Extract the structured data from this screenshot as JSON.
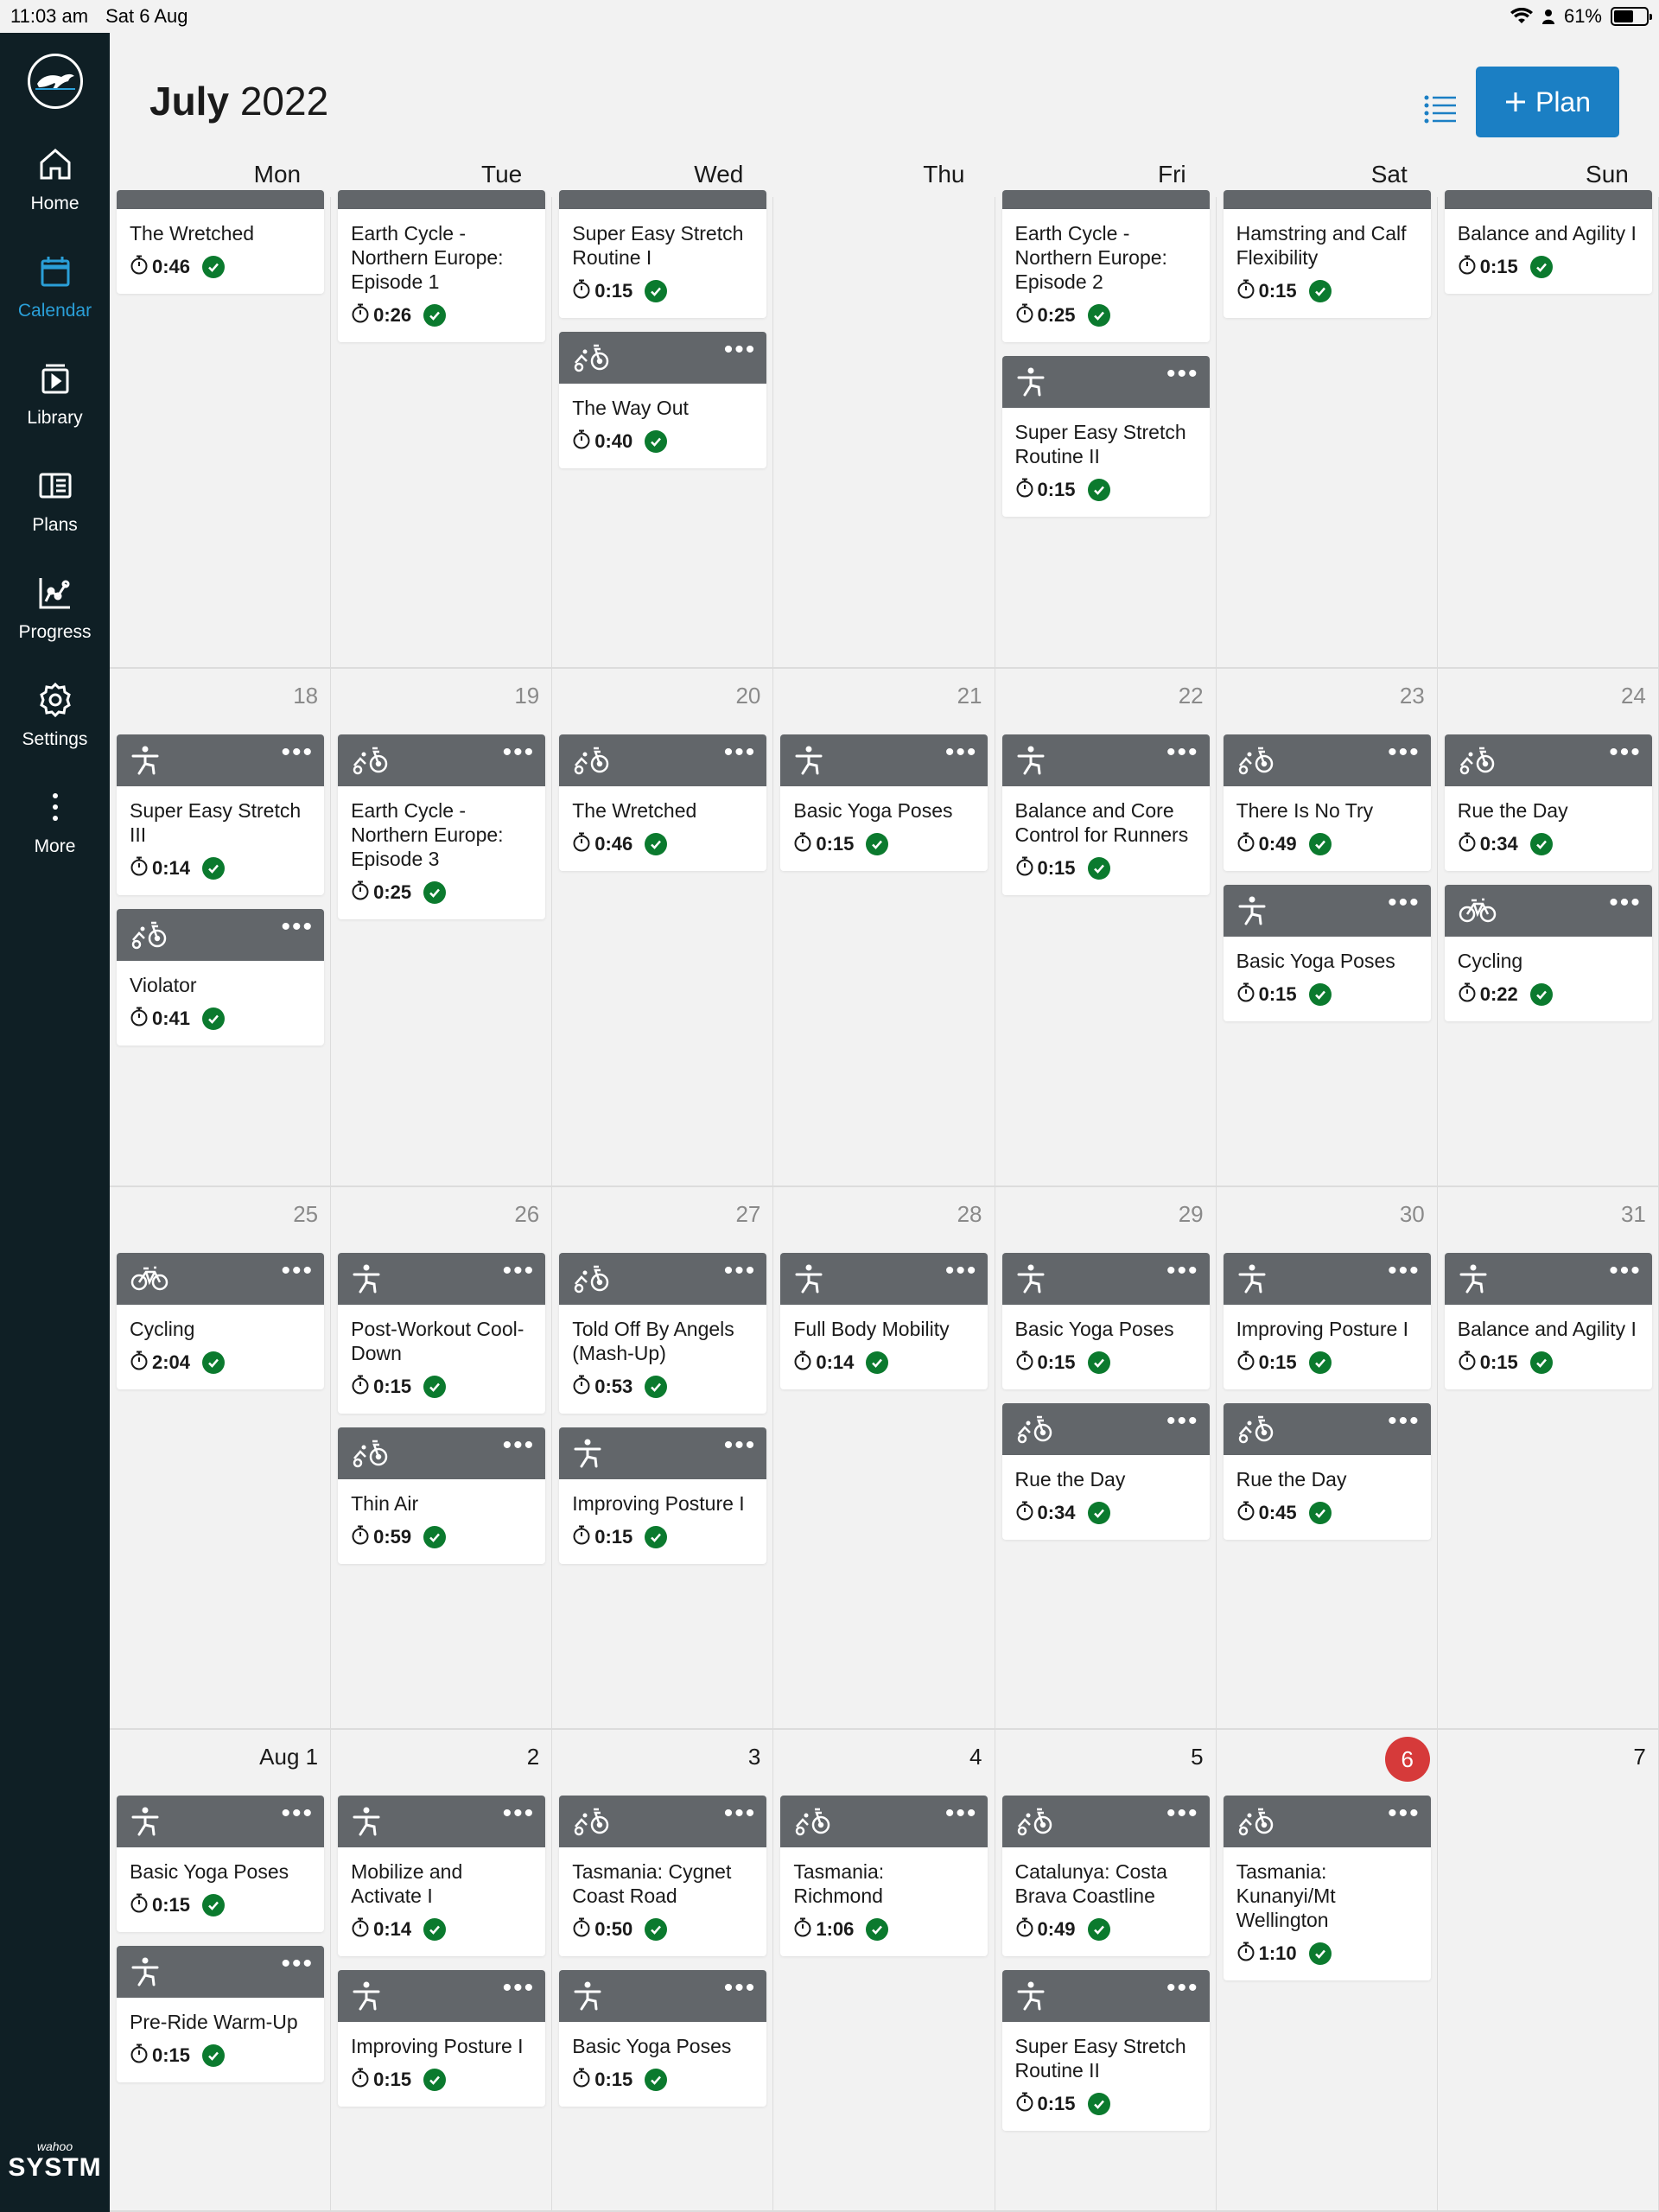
{
  "status_bar": {
    "time": "11:03 am",
    "date": "Sat 6 Aug",
    "battery": "61%",
    "battery_level": 0.61
  },
  "nav": [
    {
      "label": "Home",
      "icon": "home-icon",
      "active": false
    },
    {
      "label": "Calendar",
      "icon": "calendar-icon",
      "active": true
    },
    {
      "label": "Library",
      "icon": "library-icon",
      "active": false
    },
    {
      "label": "Plans",
      "icon": "plans-icon",
      "active": false
    },
    {
      "label": "Progress",
      "icon": "progress-icon",
      "active": false
    },
    {
      "label": "Settings",
      "icon": "gear-icon",
      "active": false
    },
    {
      "label": "More",
      "icon": "more-icon",
      "active": false
    }
  ],
  "brand": {
    "small": "wahoo",
    "big": "SYSTM"
  },
  "header": {
    "month": "July",
    "year": "2022",
    "plan_label": "Plan"
  },
  "day_headers": [
    "Mon",
    "Tue",
    "Wed",
    "Thu",
    "Fri",
    "Sat",
    "Sun"
  ],
  "colors": {
    "sidebar": "#0f1f25",
    "accent": "#1b7fc4",
    "active_nav": "#2a9fd8",
    "card_header": "#62666a",
    "done": "#0b7a2e",
    "today": "#d63a3a"
  },
  "weeks": [
    {
      "partial": true,
      "days": [
        {
          "date": "",
          "workouts": [
            {
              "title": "The Wretched",
              "duration": "0:46",
              "sport": "cycling"
            }
          ]
        },
        {
          "date": "",
          "workouts": [
            {
              "title": "Earth Cycle - Northern Europe: Episode 1",
              "duration": "0:26",
              "sport": "cycling"
            }
          ]
        },
        {
          "date": "",
          "workouts": [
            {
              "title": "Super Easy Stretch Routine I",
              "duration": "0:15",
              "sport": "yoga"
            },
            {
              "title": "The Way Out",
              "duration": "0:40",
              "sport": "cycling"
            }
          ]
        },
        {
          "date": "",
          "workouts": []
        },
        {
          "date": "",
          "workouts": [
            {
              "title": "Earth Cycle - Northern Europe: Episode 2",
              "duration": "0:25",
              "sport": "cycling"
            },
            {
              "title": "Super Easy Stretch Routine II",
              "duration": "0:15",
              "sport": "yoga"
            }
          ]
        },
        {
          "date": "",
          "workouts": [
            {
              "title": "Hamstring and Calf Flexibility",
              "duration": "0:15",
              "sport": "yoga"
            }
          ]
        },
        {
          "date": "",
          "workouts": [
            {
              "title": "Balance and Agility I",
              "duration": "0:15",
              "sport": "yoga"
            }
          ]
        }
      ]
    },
    {
      "partial": false,
      "days": [
        {
          "date": "18",
          "workouts": [
            {
              "title": "Super Easy Stretch III",
              "duration": "0:14",
              "sport": "yoga"
            },
            {
              "title": "Violator",
              "duration": "0:41",
              "sport": "cycling"
            }
          ]
        },
        {
          "date": "19",
          "workouts": [
            {
              "title": "Earth Cycle - Northern Europe: Episode 3",
              "duration": "0:25",
              "sport": "cycling"
            }
          ]
        },
        {
          "date": "20",
          "workouts": [
            {
              "title": "The Wretched",
              "duration": "0:46",
              "sport": "cycling"
            }
          ]
        },
        {
          "date": "21",
          "workouts": [
            {
              "title": "Basic Yoga Poses",
              "duration": "0:15",
              "sport": "yoga"
            }
          ]
        },
        {
          "date": "22",
          "workouts": [
            {
              "title": "Balance and Core Control for Runners",
              "duration": "0:15",
              "sport": "yoga"
            }
          ]
        },
        {
          "date": "23",
          "workouts": [
            {
              "title": "There Is No Try",
              "duration": "0:49",
              "sport": "cycling"
            },
            {
              "title": "Basic Yoga Poses",
              "duration": "0:15",
              "sport": "yoga"
            }
          ]
        },
        {
          "date": "24",
          "workouts": [
            {
              "title": "Rue the Day",
              "duration": "0:34",
              "sport": "cycling"
            },
            {
              "title": "Cycling",
              "duration": "0:22",
              "sport": "bike"
            }
          ]
        }
      ]
    },
    {
      "partial": false,
      "days": [
        {
          "date": "25",
          "workouts": [
            {
              "title": "Cycling",
              "duration": "2:04",
              "sport": "bike"
            }
          ]
        },
        {
          "date": "26",
          "workouts": [
            {
              "title": "Post-Workout Cool-Down",
              "duration": "0:15",
              "sport": "yoga"
            },
            {
              "title": "Thin Air",
              "duration": "0:59",
              "sport": "cycling"
            }
          ]
        },
        {
          "date": "27",
          "workouts": [
            {
              "title": "Told Off By Angels (Mash-Up)",
              "duration": "0:53",
              "sport": "cycling"
            },
            {
              "title": "Improving Posture I",
              "duration": "0:15",
              "sport": "yoga"
            }
          ]
        },
        {
          "date": "28",
          "workouts": [
            {
              "title": "Full Body Mobility",
              "duration": "0:14",
              "sport": "yoga"
            }
          ]
        },
        {
          "date": "29",
          "workouts": [
            {
              "title": "Basic Yoga Poses",
              "duration": "0:15",
              "sport": "yoga"
            },
            {
              "title": "Rue the Day",
              "duration": "0:34",
              "sport": "cycling"
            }
          ]
        },
        {
          "date": "30",
          "workouts": [
            {
              "title": "Improving Posture I",
              "duration": "0:15",
              "sport": "yoga"
            },
            {
              "title": "Rue the Day",
              "duration": "0:45",
              "sport": "cycling"
            }
          ]
        },
        {
          "date": "31",
          "workouts": [
            {
              "title": "Balance and Agility I",
              "duration": "0:15",
              "sport": "yoga"
            }
          ]
        }
      ]
    },
    {
      "partial": false,
      "days": [
        {
          "date": "Aug 1",
          "dark": true,
          "workouts": [
            {
              "title": "Basic Yoga Poses",
              "duration": "0:15",
              "sport": "yoga"
            },
            {
              "title": "Pre-Ride Warm-Up",
              "duration": "0:15",
              "sport": "yoga"
            }
          ]
        },
        {
          "date": "2",
          "dark": true,
          "workouts": [
            {
              "title": "Mobilize and Activate I",
              "duration": "0:14",
              "sport": "yoga"
            },
            {
              "title": "Improving Posture I",
              "duration": "0:15",
              "sport": "yoga"
            }
          ]
        },
        {
          "date": "3",
          "dark": true,
          "workouts": [
            {
              "title": "Tasmania: Cygnet Coast Road",
              "duration": "0:50",
              "sport": "cycling"
            },
            {
              "title": "Basic Yoga Poses",
              "duration": "0:15",
              "sport": "yoga"
            }
          ]
        },
        {
          "date": "4",
          "dark": true,
          "workouts": [
            {
              "title": "Tasmania: Richmond",
              "duration": "1:06",
              "sport": "cycling"
            }
          ]
        },
        {
          "date": "5",
          "dark": true,
          "workouts": [
            {
              "title": "Catalunya: Costa Brava Coastline",
              "duration": "0:49",
              "sport": "cycling"
            },
            {
              "title": "Super Easy Stretch Routine II",
              "duration": "0:15",
              "sport": "yoga"
            }
          ]
        },
        {
          "date": "6",
          "today": true,
          "workouts": [
            {
              "title": "Tasmania: Kunanyi/Mt Wellington",
              "duration": "1:10",
              "sport": "cycling"
            }
          ]
        },
        {
          "date": "7",
          "dark": true,
          "workouts": []
        }
      ]
    }
  ]
}
